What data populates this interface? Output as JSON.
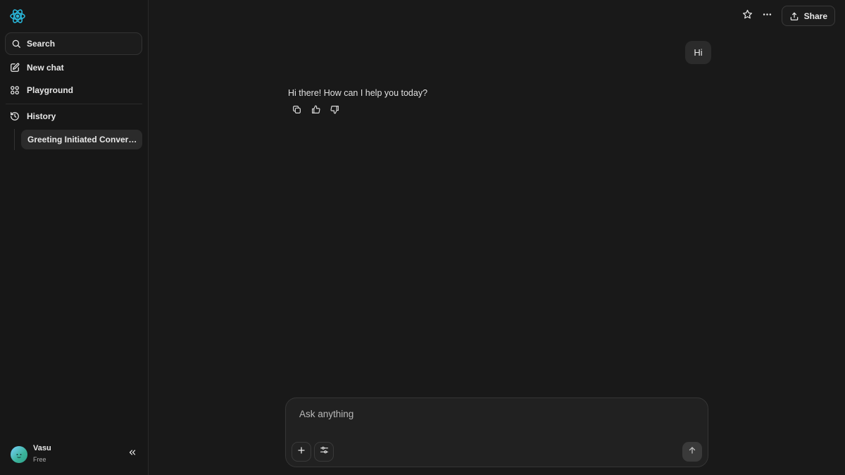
{
  "sidebar": {
    "search_label": "Search",
    "new_chat_label": "New chat",
    "playground_label": "Playground",
    "history_label": "History",
    "history_items": [
      {
        "title": "Greeting Initiated Conversa..."
      }
    ],
    "user": {
      "name": "Vasu",
      "plan": "Free"
    }
  },
  "header": {
    "share_label": "Share"
  },
  "conversation": {
    "user_message": "Hi",
    "assistant_message": "Hi there! How can I help you today?"
  },
  "composer": {
    "placeholder": "Ask anything"
  },
  "colors": {
    "background": "#191919",
    "sidebar": "#171717",
    "accent_logo": "#29b6d9"
  },
  "icons": {
    "logo": "atom-logo-icon",
    "search": "search-icon",
    "new_chat": "edit-icon",
    "playground": "grid-icon",
    "history": "history-icon",
    "collapse": "chevrons-left-icon",
    "star": "star-icon",
    "more": "more-horizontal-icon",
    "share": "upload-icon",
    "copy": "copy-icon",
    "thumbs_up": "thumbs-up-icon",
    "thumbs_down": "thumbs-down-icon",
    "add": "plus-icon",
    "tools": "sliders-icon",
    "send": "arrow-up-icon"
  }
}
